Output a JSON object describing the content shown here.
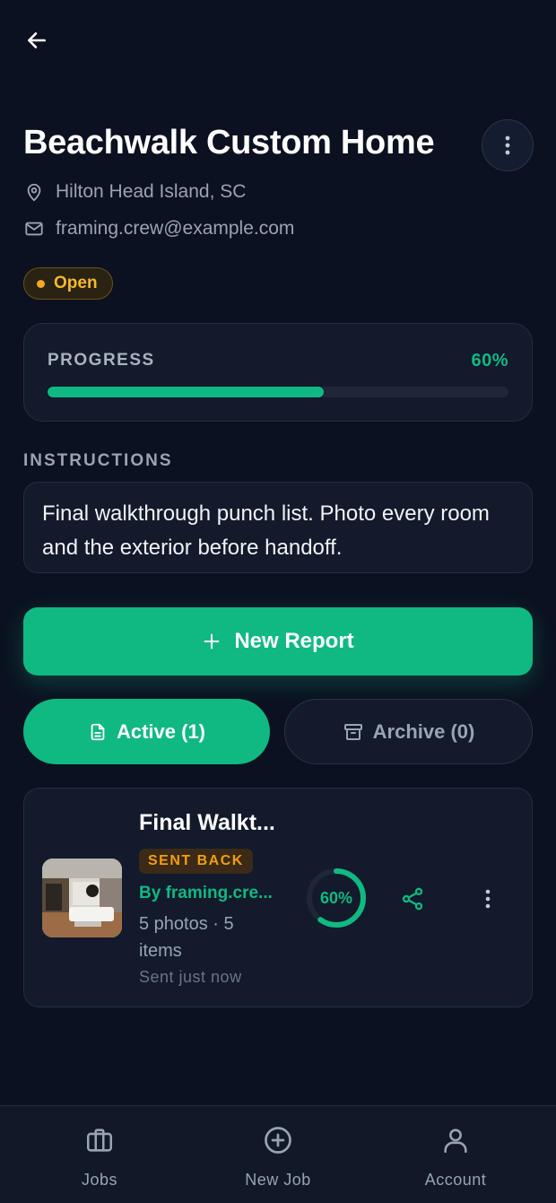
{
  "header": {
    "title": "Beachwalk Custom Home",
    "location": "Hilton Head Island, SC",
    "email": "framing.crew@example.com",
    "status": "Open"
  },
  "progress": {
    "label": "PROGRESS",
    "value_text": "60%",
    "value": 0.6
  },
  "instructions": {
    "label": "INSTRUCTIONS",
    "text": "Final walkthrough punch list. Photo every room and the exterior before handoff."
  },
  "actions": {
    "new_report": "New Report"
  },
  "tabs": [
    {
      "label": "Active (1)",
      "selected": true
    },
    {
      "label": "Archive (0)",
      "selected": false
    }
  ],
  "reports": [
    {
      "title": "Final Walkt...",
      "status": "SENT BACK",
      "author": "By framing.cre...",
      "counts": "5 photos · 5 items",
      "time": "Sent just now",
      "progress_text": "60%",
      "progress": 0.6
    }
  ],
  "nav": [
    {
      "label": "Jobs",
      "icon": "briefcase-icon"
    },
    {
      "label": "New Job",
      "icon": "plus-circle-icon"
    },
    {
      "label": "Account",
      "icon": "user-icon"
    }
  ],
  "colors": {
    "background": "#0b1120",
    "card": "#121a2c",
    "accent": "#10b981",
    "warning": "#f59e0b"
  }
}
